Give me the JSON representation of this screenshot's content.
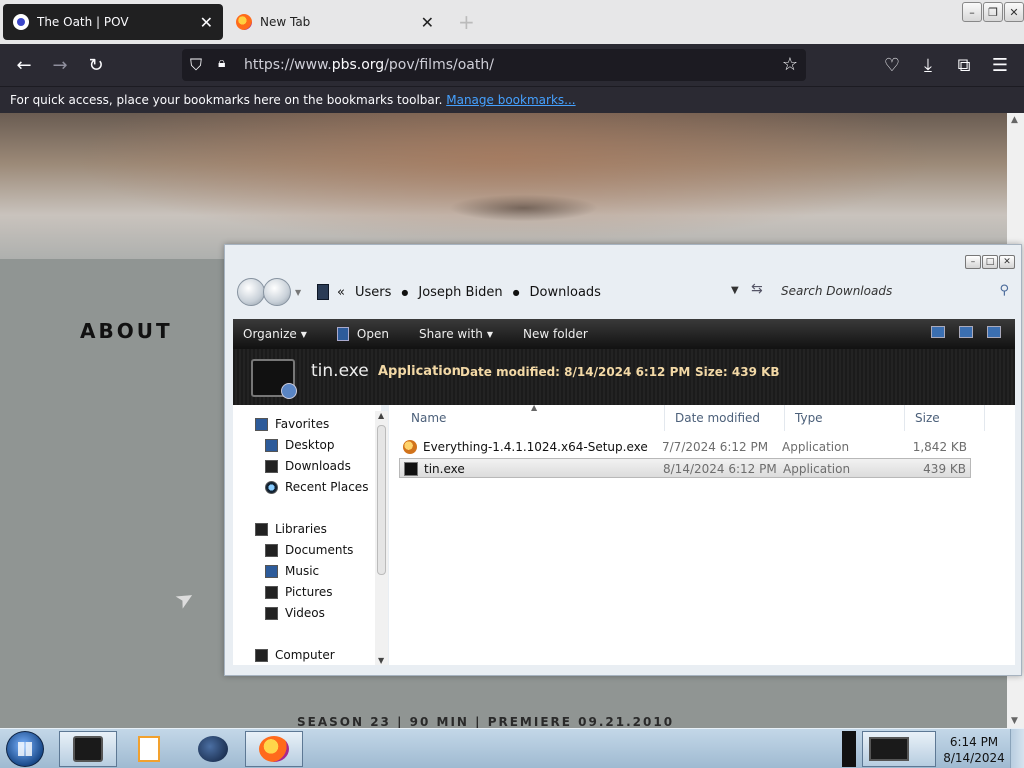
{
  "browser": {
    "tabs": [
      {
        "title": "The Oath | POV",
        "active": true
      },
      {
        "title": "New Tab",
        "active": false
      }
    ],
    "new_tab_symbol": "+",
    "url_prefix": "https://www.",
    "url_domain": "pbs.org",
    "url_path": "/pov/films/oath/",
    "bookmarks_message": "For quick access, place your bookmarks here on the bookmarks toolbar.",
    "bookmarks_link": "Manage bookmarks...",
    "icons": [
      "back-icon",
      "forward-icon",
      "reload-icon",
      "shield-icon",
      "lock-icon",
      "star-icon",
      "pocket-icon",
      "download-icon",
      "extensions-icon",
      "menu-icon"
    ]
  },
  "page": {
    "about_heading": "ABOUT",
    "season_info": "SEASON 23  |  90 MIN  |  PREMIERE 09.21.2010"
  },
  "explorer": {
    "breadcrumb": {
      "overflow": "«",
      "items": [
        "Users",
        "Joseph Biden",
        "Downloads"
      ]
    },
    "search_placeholder": "Search Downloads",
    "toolbar": {
      "organize": "Organize",
      "open": "Open",
      "share_with": "Share with",
      "new_folder": "New folder"
    },
    "details": {
      "name": "tin.exe",
      "type": "Application",
      "date_label": "Date modified:",
      "date_value": "8/14/2024 6:12 PM",
      "size_label": "Size:",
      "size_value": "439 KB"
    },
    "nav": {
      "favorites": {
        "label": "Favorites",
        "items": [
          "Desktop",
          "Downloads",
          "Recent Places"
        ]
      },
      "libraries": {
        "label": "Libraries",
        "items": [
          "Documents",
          "Music",
          "Pictures",
          "Videos"
        ]
      },
      "computer": "Computer"
    },
    "columns": [
      "Name",
      "Date modified",
      "Type",
      "Size"
    ],
    "files": [
      {
        "name": "Everything-1.4.1.1024.x64-Setup.exe",
        "date": "7/7/2024 6:12 PM",
        "type": "Application",
        "size": "1,842 KB",
        "icon": "installer-icon",
        "selected": false
      },
      {
        "name": "tin.exe",
        "date": "8/14/2024 6:12 PM",
        "type": "Application",
        "size": "439 KB",
        "icon": "exe-icon",
        "selected": true
      }
    ]
  },
  "taskbar": {
    "apps": [
      "file-explorer-icon",
      "media-player-icon",
      "globe-browser-icon",
      "firefox-icon"
    ],
    "time": "6:14 PM",
    "date": "8/14/2024"
  }
}
